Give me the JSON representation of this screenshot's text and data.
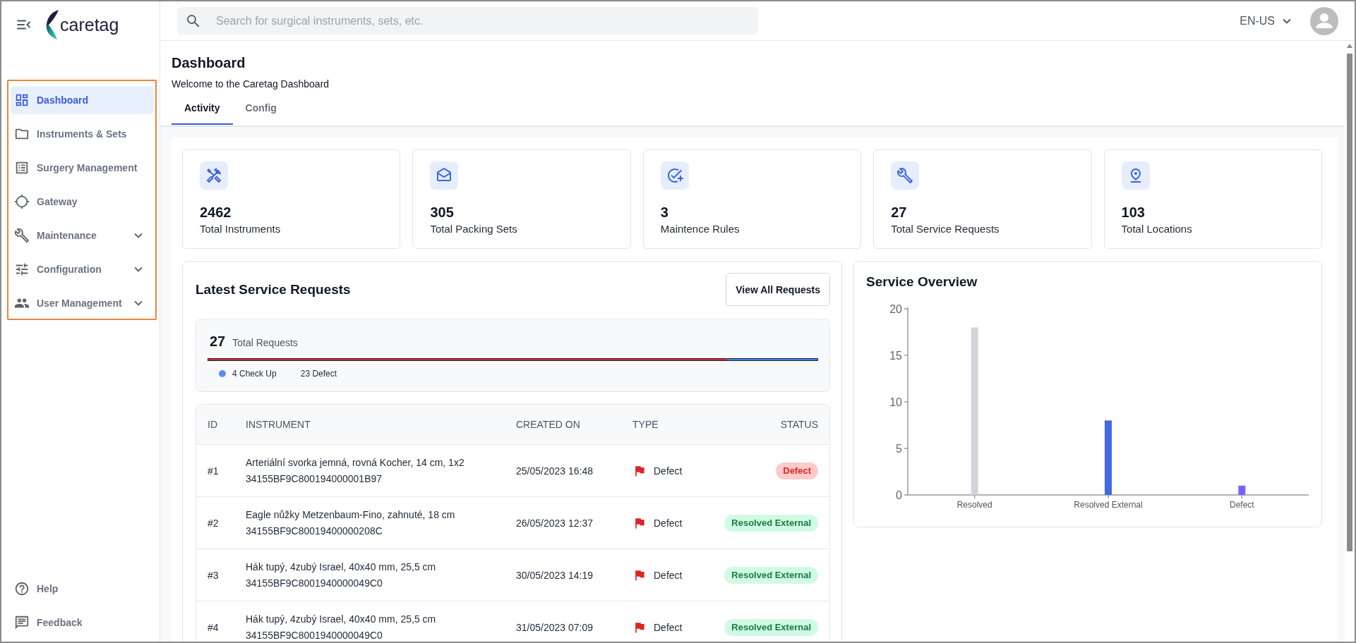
{
  "sidebar": {
    "logo": "caretag",
    "nav_items": [
      {
        "label": "Dashboard",
        "kind": "link",
        "selected": true
      },
      {
        "label": "Instruments & Sets",
        "kind": "link",
        "selected": false
      },
      {
        "label": "Surgery Management",
        "kind": "link",
        "selected": false
      },
      {
        "label": "Gateway",
        "kind": "link",
        "selected": false
      },
      {
        "label": "Maintenance",
        "kind": "group",
        "selected": false
      },
      {
        "label": "Configuration",
        "kind": "group",
        "selected": false
      },
      {
        "label": "User Management",
        "kind": "group",
        "selected": false
      }
    ],
    "footer_items": [
      {
        "label": "Help"
      },
      {
        "label": "Feedback"
      }
    ]
  },
  "header": {
    "search": {
      "placeholder": "Search for surgical instruments, sets, etc."
    },
    "language": "EN-US"
  },
  "page": {
    "title": "Dashboard",
    "subtitle": "Welcome to the Caretag Dashboard",
    "tabs": [
      {
        "label": "Activity",
        "selected": true
      },
      {
        "label": "Config",
        "selected": false
      }
    ]
  },
  "stats": [
    {
      "value": "2462",
      "label": "Total Instruments"
    },
    {
      "value": "305",
      "label": "Total Packing Sets"
    },
    {
      "value": "3",
      "label": "Maintence Rules"
    },
    {
      "value": "27",
      "label": "Total Service Requests"
    },
    {
      "value": "103",
      "label": "Total Locations"
    }
  ],
  "requests": {
    "title": "Latest Service Requests",
    "button": "View All Requests",
    "summary": {
      "count": "27",
      "label": "Total Requests",
      "bar": {
        "level": 0.852
      },
      "legend": [
        {
          "label": "4 Check Up",
          "color": "#5b8def"
        },
        {
          "label": "23 Defect"
        }
      ]
    },
    "table": {
      "columns": [
        "ID",
        "INSTRUMENT",
        "CREATED ON",
        "TYPE",
        "STATUS"
      ],
      "rows": [
        {
          "id": "#1",
          "instrument": "Arteriální svorka jemná, rovná Kocher, 14 cm, 1x2",
          "tag": "34155BF9C800194000001B97",
          "created_on": "25/05/2023 16:48",
          "type": "Defect",
          "status": {
            "label": "Defect",
            "kind": "defect"
          }
        },
        {
          "id": "#2",
          "instrument": "Eagle nůžky Metzenbaum-Fino, zahnuté, 18 cm",
          "tag": "34155BF9C80019400000208C",
          "created_on": "26/05/2023 12:37",
          "type": "Defect",
          "status": {
            "label": "Resolved External",
            "kind": "resolved_external"
          }
        },
        {
          "id": "#3",
          "instrument": "Hák tupý, 4zubý Israel, 40x40 mm, 25,5 cm",
          "tag": "34155BF9C8001940000049C0",
          "created_on": "30/05/2023 14:19",
          "type": "Defect",
          "status": {
            "label": "Resolved External",
            "kind": "resolved_external"
          }
        },
        {
          "id": "#4",
          "instrument": "Hák tupý, 4zubý Israel, 40x40 mm, 25,5 cm",
          "tag": "34155BF9C8001940000049C0",
          "created_on": "31/05/2023 07:09",
          "type": "Defect",
          "status": {
            "label": "Resolved External",
            "kind": "resolved_external"
          }
        }
      ]
    }
  },
  "overview": {
    "title": "Service Overview",
    "chart_data": {
      "type": "bar",
      "categories": [
        "Resolved",
        "Resolved External",
        "Defect"
      ],
      "series": [
        {
          "values": [
            18,
            8,
            1
          ],
          "colors": [
            "#d1d5db",
            "#4169e1",
            "#7b61ff"
          ]
        }
      ],
      "ylim": [
        0,
        20
      ],
      "yticks": [
        0,
        5,
        10,
        15,
        20
      ]
    }
  }
}
